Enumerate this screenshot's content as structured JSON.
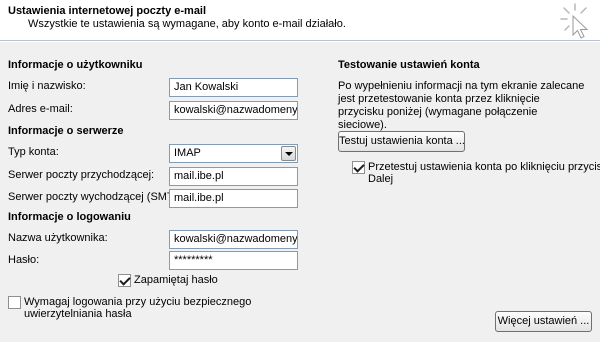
{
  "header": {
    "title": "Ustawienia internetowej poczty e-mail",
    "subtitle": "Wszystkie te ustawienia są wymagane, aby konto e-mail działało."
  },
  "user_info": {
    "title": "Informacje o użytkowniku",
    "name_label": "Imię i nazwisko:",
    "name_value": "Jan Kowalski",
    "email_label": "Adres e-mail:",
    "email_value": "kowalski@nazwadomeny.pl"
  },
  "server_info": {
    "title": "Informacje o serwerze",
    "account_type_label": "Typ konta:",
    "account_type_value": "IMAP",
    "incoming_label": "Serwer poczty przychodzącej:",
    "incoming_value": "mail.ibe.pl",
    "outgoing_label": "Serwer poczty wychodzącej (SMTP):",
    "outgoing_value": "mail.ibe.pl"
  },
  "login_info": {
    "title": "Informacje o logowaniu",
    "username_label": "Nazwa użytkownika:",
    "username_value": "kowalski@nazwadomeny.pl",
    "password_label": "Hasło:",
    "password_value": "*********",
    "remember_label": "Zapamiętaj hasło",
    "remember_checked": true,
    "spa_label_line1": "Wymagaj logowania przy użyciu bezpiecznego",
    "spa_label_line2": "uwierzytelniania hasła",
    "spa_checked": false
  },
  "test_settings": {
    "title": "Testowanie ustawień konta",
    "description": "Po wypełnieniu informacji na tym ekranie zalecane jest przetestowanie konta przez kliknięcie przycisku poniżej (wymagane połączenie sieciowe).",
    "test_button": "Testuj ustawienia konta ...",
    "auto_test_label_line1": "Przetestuj ustawienia konta po kliknięciu przycisku",
    "auto_test_label_line2": "Dalej",
    "auto_test_checked": true
  },
  "more_settings_button": "Więcej ustawień ...",
  "icons": {
    "header_cursor": "cursor-click-icon",
    "select_arrow": "chevron-down-icon"
  }
}
